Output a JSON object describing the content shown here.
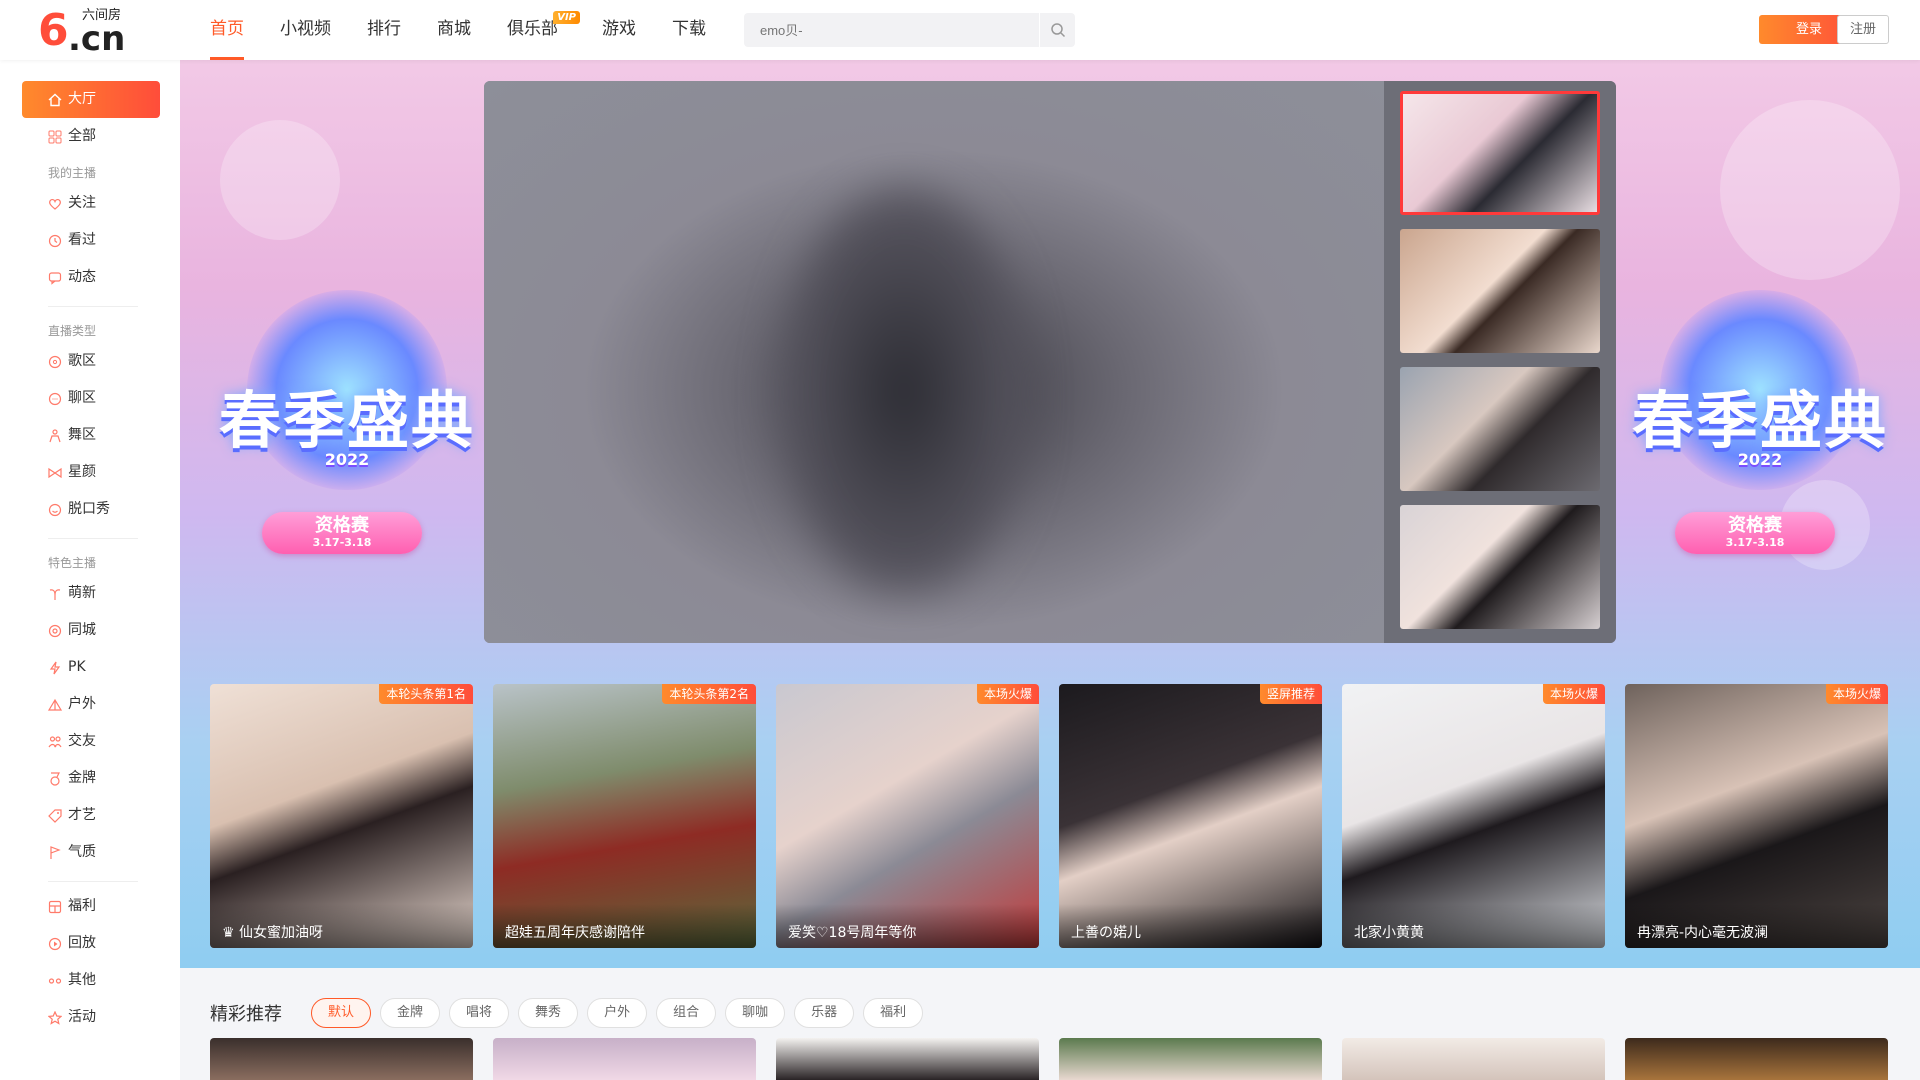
{
  "header": {
    "logo_brand": "六间房",
    "logo_six": "6",
    "logo_cn": ".cn",
    "nav": [
      {
        "label": "首页",
        "active": true
      },
      {
        "label": "小视频"
      },
      {
        "label": "排行"
      },
      {
        "label": "商城"
      },
      {
        "label": "俱乐部",
        "badge": "VIP"
      },
      {
        "label": "游戏"
      },
      {
        "label": "下载"
      }
    ],
    "search_placeholder": "emo贝-",
    "login_label": "登录",
    "register_label": "注册"
  },
  "sidebar": {
    "hall": "大厅",
    "all": "全部",
    "group_my": "我的主播",
    "follow": "关注",
    "viewed": "看过",
    "dynamic": "动态",
    "group_type": "直播类型",
    "song": "歌区",
    "chat": "聊区",
    "dance": "舞区",
    "star": "星颜",
    "talkshow": "脱口秀",
    "group_special": "特色主播",
    "newbie": "萌新",
    "samecity": "同城",
    "pk": "PK",
    "outdoor": "户外",
    "friends": "交友",
    "gold": "金牌",
    "talent": "才艺",
    "temperament": "气质",
    "welfare": "福利",
    "replay": "回放",
    "other": "其他",
    "activity": "活动"
  },
  "promo": {
    "title": "春季盛典",
    "year": "2022",
    "stage": "资格赛",
    "dates": "3.17-3.18"
  },
  "hot_cards": [
    {
      "tag": "本轮头条第1名",
      "name": "♛ 仙女蜜加油呀"
    },
    {
      "tag": "本轮头条第2名",
      "name": "超娃五周年庆感谢陪伴"
    },
    {
      "tag": "本场火爆",
      "name": "爱笑♡18号周年等你"
    },
    {
      "tag": "竖屏推荐",
      "name": "上善の婼儿"
    },
    {
      "tag": "本场火爆",
      "name": "北家小黄黄"
    },
    {
      "tag": "本场火爆",
      "name": "冉漂亮-内心毫无波澜"
    }
  ],
  "recommend": {
    "title": "精彩推荐",
    "filters": [
      "默认",
      "金牌",
      "唱将",
      "舞秀",
      "户外",
      "组合",
      "聊咖",
      "乐器",
      "福利"
    ]
  },
  "colors": {
    "accent": "#ff5a28",
    "accent_gradient_start": "#ff8a2c",
    "accent_gradient_end": "#ff4d3a",
    "selected_thumb_border": "#ff3a3a"
  },
  "icons": {
    "search": "magnifier-icon",
    "hall": "home-icon"
  }
}
